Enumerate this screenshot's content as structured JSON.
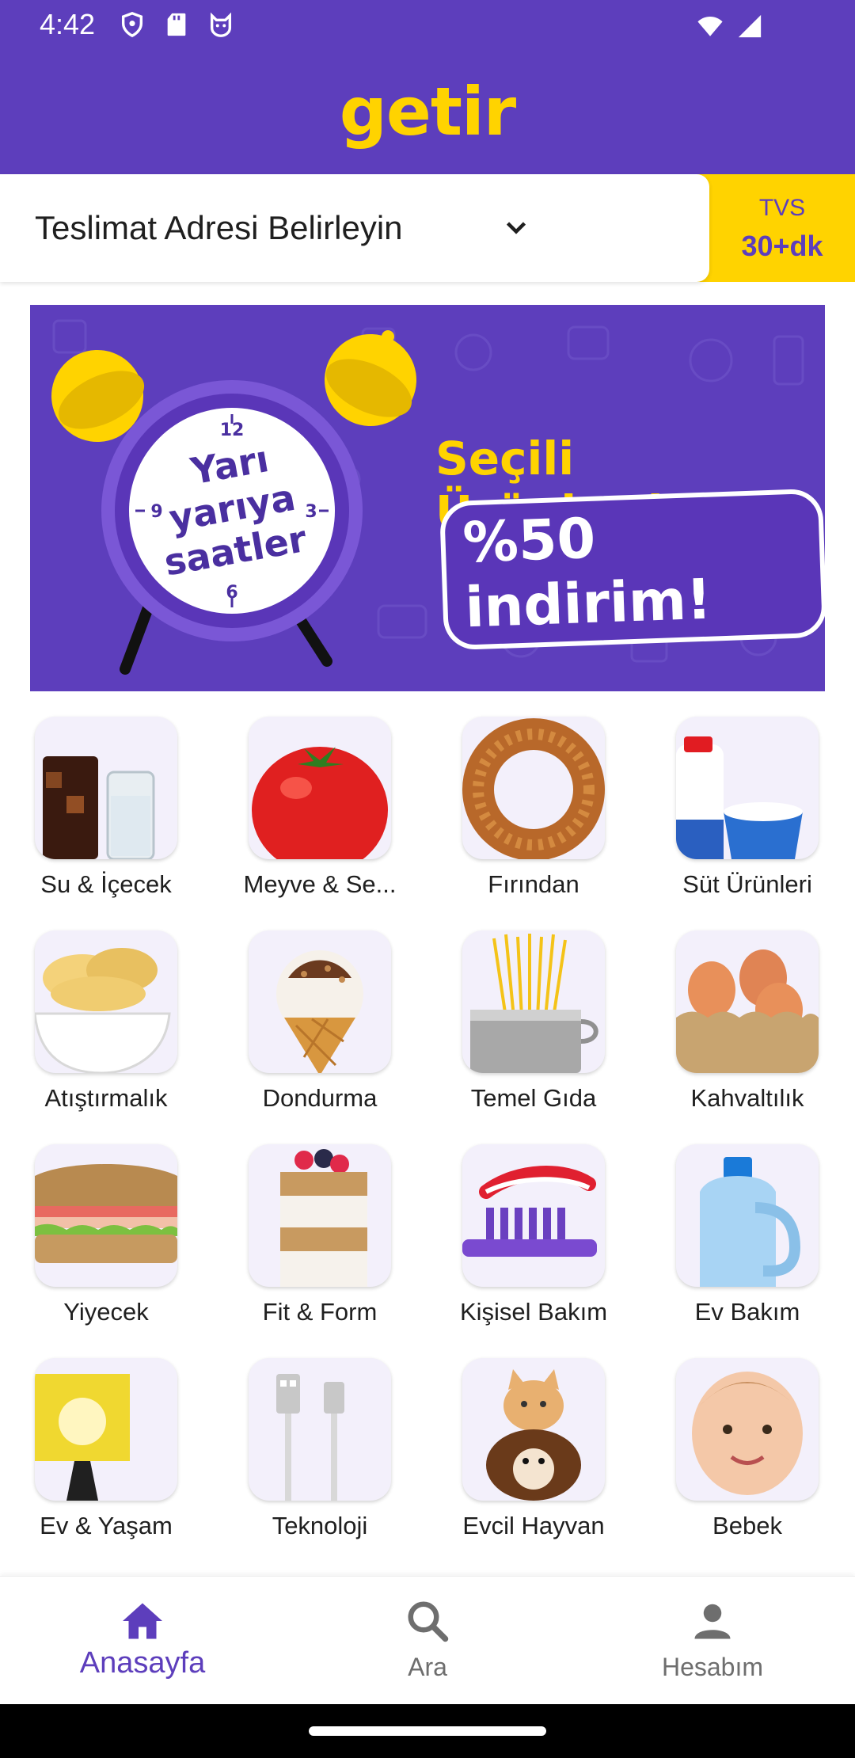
{
  "status_bar": {
    "time": "4:42",
    "icons_left": [
      "shield-icon",
      "sd-card-icon",
      "cat-face-icon"
    ],
    "icons_right": [
      "wifi-icon",
      "signal-icon"
    ]
  },
  "header": {
    "logo": "getir",
    "brand_color": "#5d3ebc",
    "accent_color": "#ffd300"
  },
  "address_bar": {
    "label": "Teslimat Adresi Belirleyin",
    "eta_label": "TVS",
    "eta_time": "30+dk"
  },
  "banner": {
    "clock_line1": "Yarı",
    "clock_line2": "yarıya",
    "clock_line3": "saatler",
    "headline": "Seçili Ürünlerde",
    "discount": "%50 indirim!"
  },
  "categories": [
    {
      "label": "Su & İçecek",
      "icon": "drinks-icon"
    },
    {
      "label": "Meyve & Se...",
      "icon": "tomato-icon"
    },
    {
      "label": "Fırından",
      "icon": "simit-icon"
    },
    {
      "label": "Süt Ürünleri",
      "icon": "milk-icon"
    },
    {
      "label": "Atıştırmalık",
      "icon": "chips-icon"
    },
    {
      "label": "Dondurma",
      "icon": "ice-cream-icon"
    },
    {
      "label": "Temel Gıda",
      "icon": "pasta-icon"
    },
    {
      "label": "Kahvaltılık",
      "icon": "eggs-icon"
    },
    {
      "label": "Yiyecek",
      "icon": "sandwich-icon"
    },
    {
      "label": "Fit & Form",
      "icon": "parfait-icon"
    },
    {
      "label": "Kişisel Bakım",
      "icon": "toothbrush-icon"
    },
    {
      "label": "Ev Bakım",
      "icon": "detergent-icon"
    },
    {
      "label": "Ev & Yaşam",
      "icon": "lamp-icon"
    },
    {
      "label": "Teknoloji",
      "icon": "cable-icon"
    },
    {
      "label": "Evcil Hayvan",
      "icon": "pets-icon"
    },
    {
      "label": "Bebek",
      "icon": "baby-icon"
    }
  ],
  "bottom_nav": {
    "items": [
      {
        "label": "Anasayfa",
        "icon": "home-icon",
        "active": true
      },
      {
        "label": "Ara",
        "icon": "search-icon",
        "active": false
      },
      {
        "label": "Hesabım",
        "icon": "person-icon",
        "active": false
      }
    ]
  }
}
